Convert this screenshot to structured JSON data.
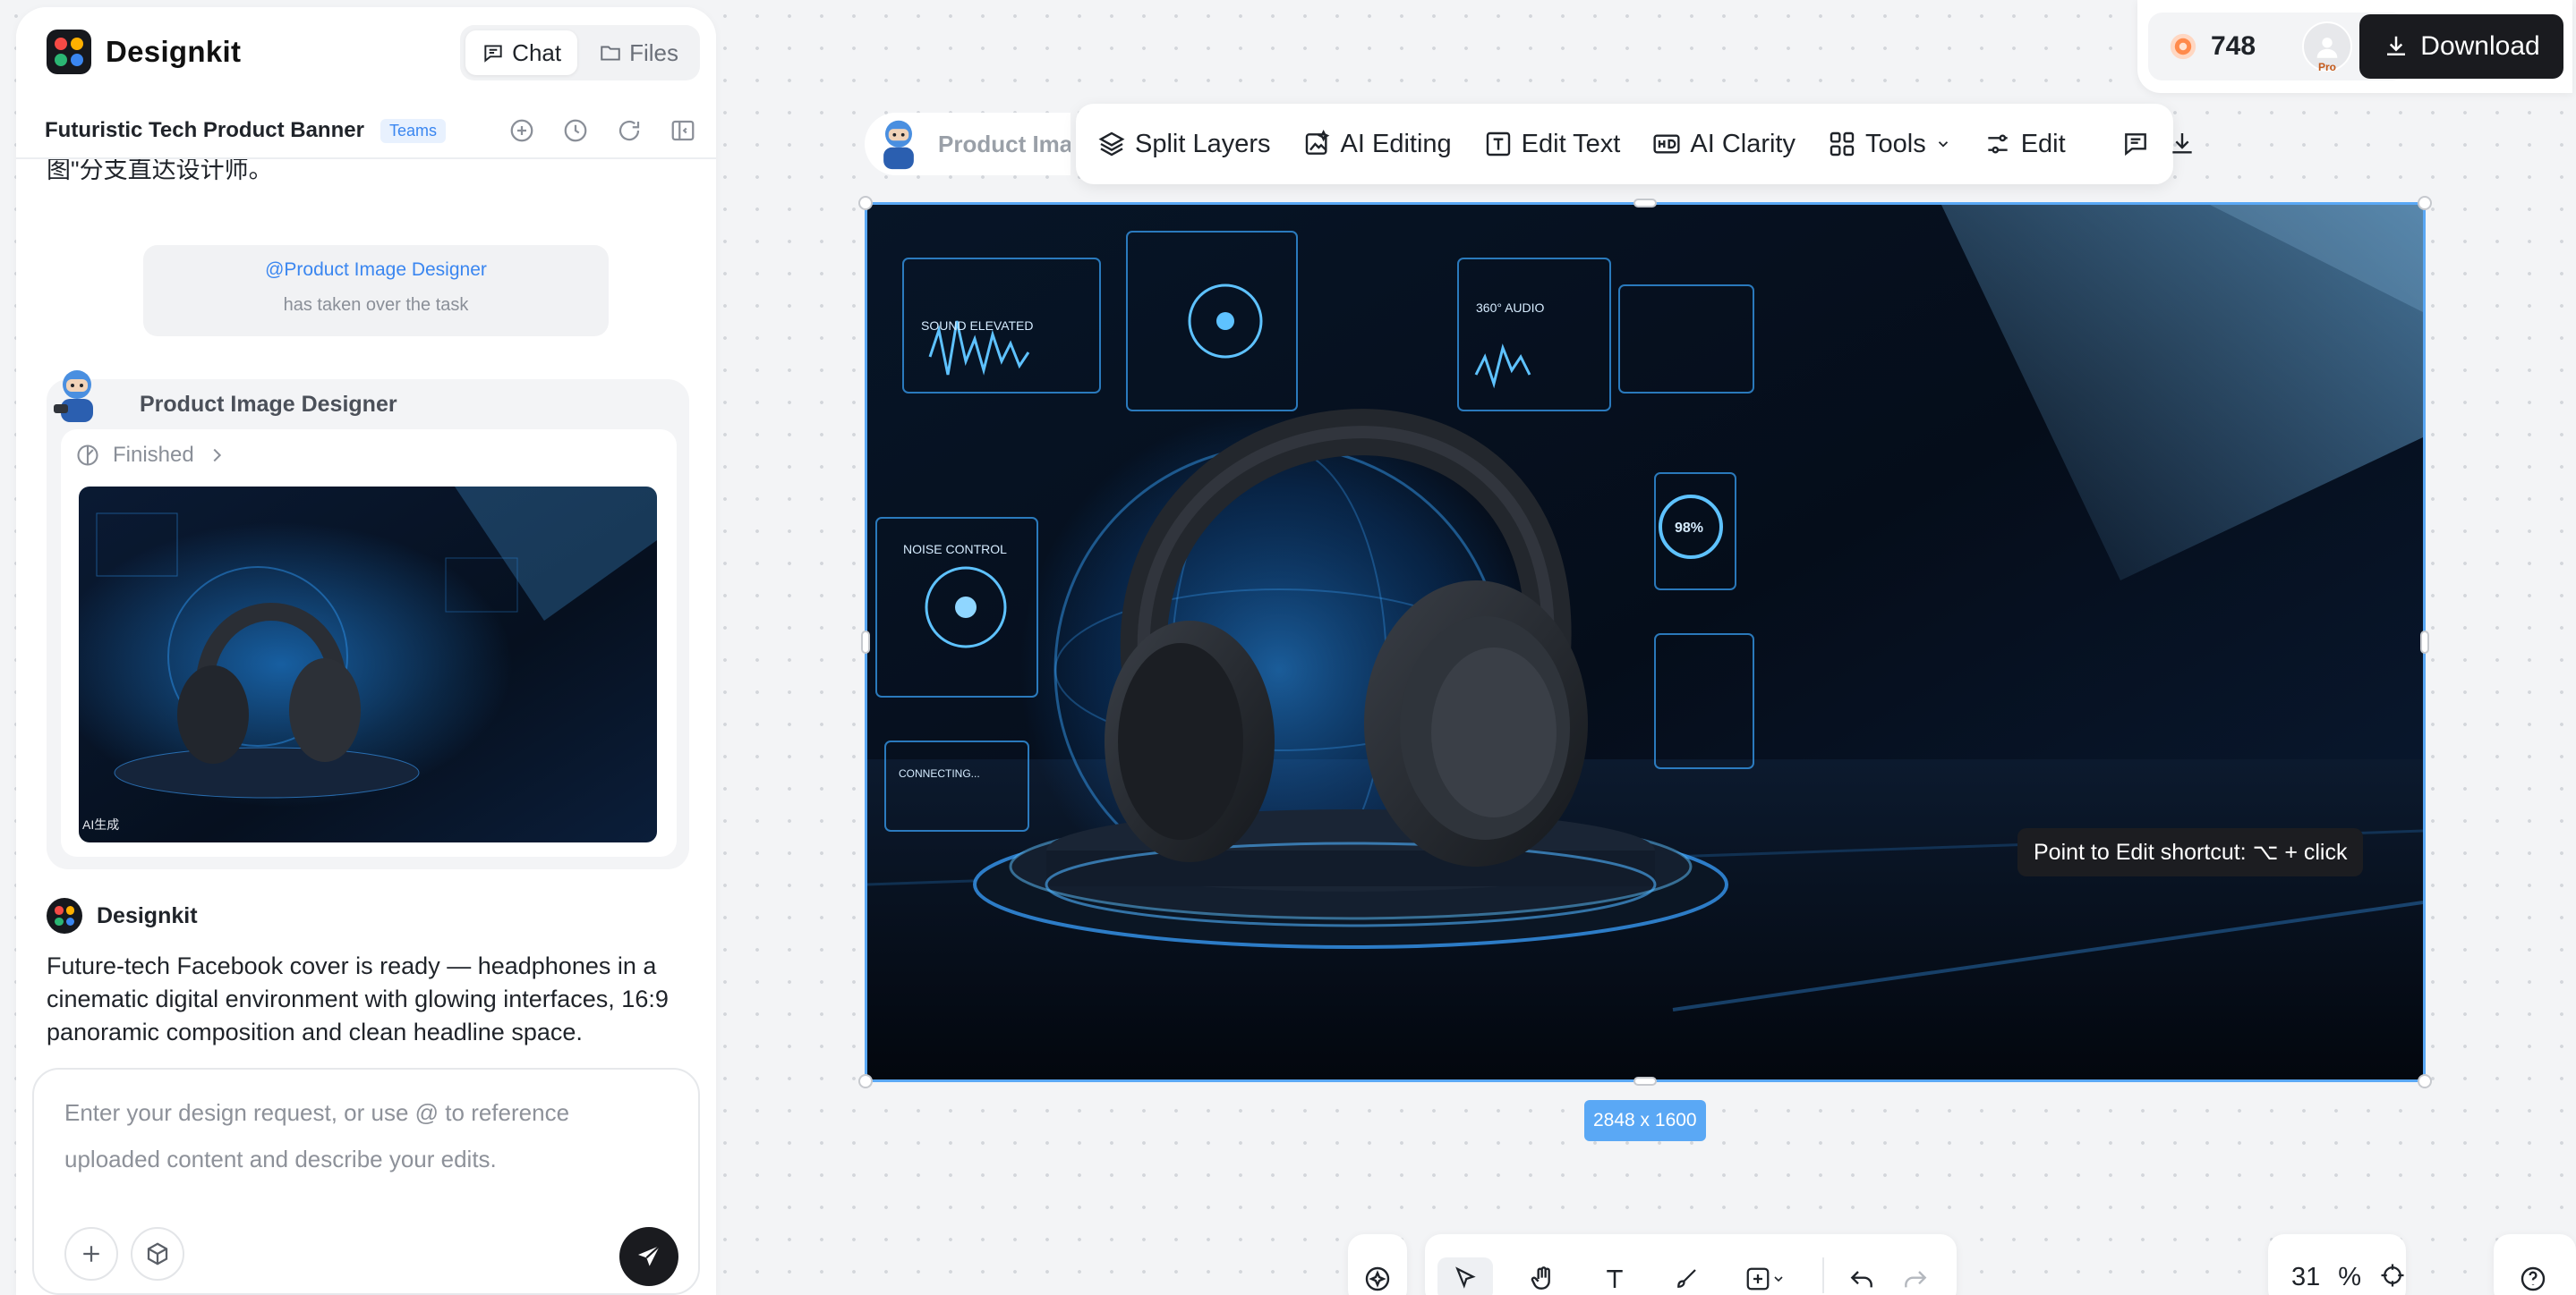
{
  "app": {
    "name": "Designkit"
  },
  "tabs": [
    {
      "label": "Chat",
      "icon": "chat-bubble-icon",
      "active": true
    },
    {
      "label": "Files",
      "icon": "folder-icon",
      "active": false
    }
  ],
  "project": {
    "title": "Futuristic Tech Product Banner",
    "badge": "Teams"
  },
  "chat": {
    "truncated_text": "图\"分支直达设计师。",
    "handoff": {
      "mention": "@Product Image Designer",
      "status": "has taken over the task"
    },
    "agent_card": {
      "agent_name": "Product Image Designer",
      "status": "Finished",
      "thumb_caption": "AI生成"
    },
    "assistant": {
      "name": "Designkit",
      "message": "Future-tech Facebook cover is ready — headphones in a cinematic digital environment with glowing interfaces, 16:9 panoramic composition and clean headline space."
    }
  },
  "composer": {
    "placeholder": "Enter your design request, or use @ to reference uploaded content and describe your edits."
  },
  "canvas": {
    "image_name": "Product Image Designer",
    "image_name_visible": "Product Imag",
    "dimensions": "2848 x 1600",
    "tooltip": "Point to Edit shortcut: ⌥ + click",
    "image_texts": {
      "sound": "SOUND ELEVATED",
      "audio": "360° AUDIO",
      "noise": "NOISE CONTROL",
      "connecting": "CONNECTING...",
      "percent": "98%"
    }
  },
  "toolbar": {
    "items": [
      {
        "label": "Split Layers",
        "icon": "layers-icon"
      },
      {
        "label": "AI Editing",
        "icon": "ai-edit-image-icon"
      },
      {
        "label": "Edit Text",
        "icon": "text-box-icon"
      },
      {
        "label": "AI Clarity",
        "icon": "hd-icon"
      },
      {
        "label": "Tools",
        "icon": "grid-icon"
      },
      {
        "label": "Edit",
        "icon": "sliders-icon"
      }
    ]
  },
  "header": {
    "credits": "748",
    "user_badge": "Pro",
    "download_label": "Download"
  },
  "bottom_bar": {
    "zoom_value": "31",
    "zoom_unit": "%"
  },
  "colors": {
    "accent": "#5aa8f5",
    "link": "#3a86f0",
    "dark_button": "#1a1b1f",
    "logo": [
      "#f54a45",
      "#ffb000",
      "#2bb673",
      "#3a86f0"
    ]
  }
}
